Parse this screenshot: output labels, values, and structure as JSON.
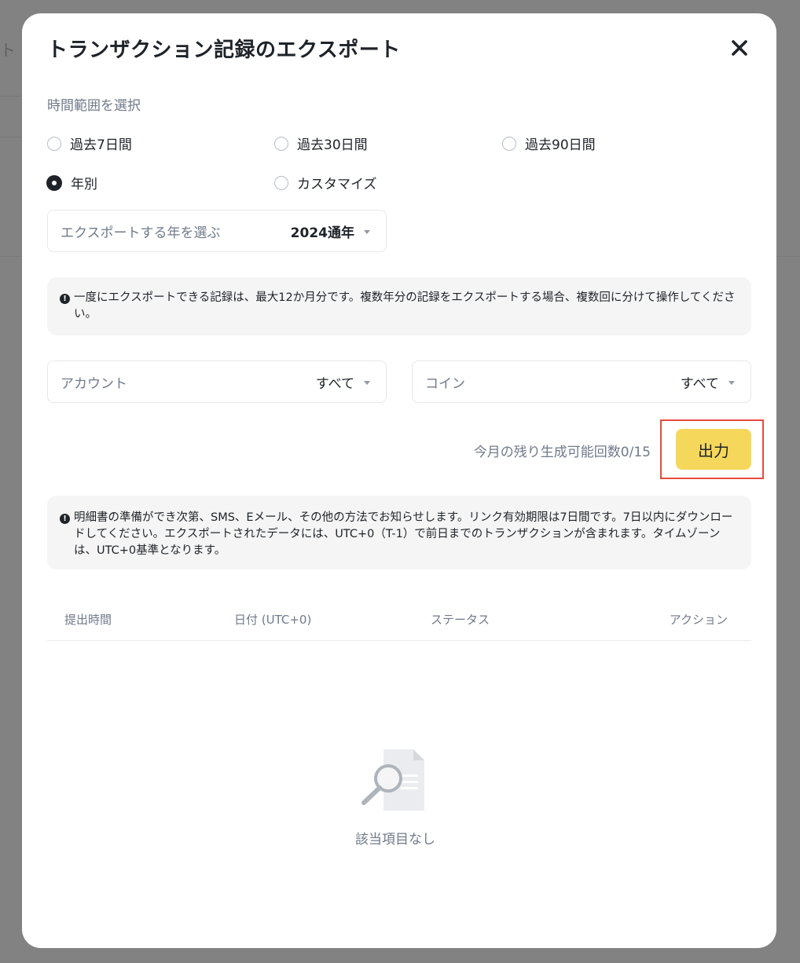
{
  "background": {
    "fragment_text": "ト"
  },
  "modal": {
    "title": "トランザクション記録のエクスポート",
    "time_range_label": "時間範囲を選択",
    "time_range_options": [
      {
        "label": "過去7日間",
        "checked": false
      },
      {
        "label": "過去30日間",
        "checked": false
      },
      {
        "label": "過去90日間",
        "checked": false
      },
      {
        "label": "年別",
        "checked": true
      },
      {
        "label": "カスタマイズ",
        "checked": false
      }
    ],
    "year_select": {
      "label": "エクスポートする年を選ぶ",
      "value": "2024通年"
    },
    "notice_1": "一度にエクスポートできる記録は、最大12か月分です。複数年分の記録をエクスポートする場合、複数回に分けて操作してください。",
    "account_select": {
      "label": "アカウント",
      "value": "すべて"
    },
    "coin_select": {
      "label": "コイン",
      "value": "すべて"
    },
    "remaining_text": "今月の残り生成可能回数0/15",
    "export_button": "出力",
    "notice_2": "明細書の準備ができ次第、SMS、Eメール、その他の方法でお知らせします。リンク有効期限は7日間です。7日以内にダウンロードしてください。エクスポートされたデータには、UTC+0（T-1）で前日までのトランザクションが含まれます。タイムゾーンは、UTC+0基準となります。",
    "table_headers": [
      "提出時間",
      "日付 (UTC+0)",
      "ステータス",
      "アクション"
    ],
    "empty_text": "該当項目なし"
  },
  "colors": {
    "accent_button": "#f5d75b",
    "highlight_border": "#e64c3c",
    "overlay": "#828282"
  },
  "icons": {
    "close": "close-icon",
    "info": "info-icon",
    "empty": "empty-search-document-icon",
    "caret": "caret-down-icon"
  }
}
